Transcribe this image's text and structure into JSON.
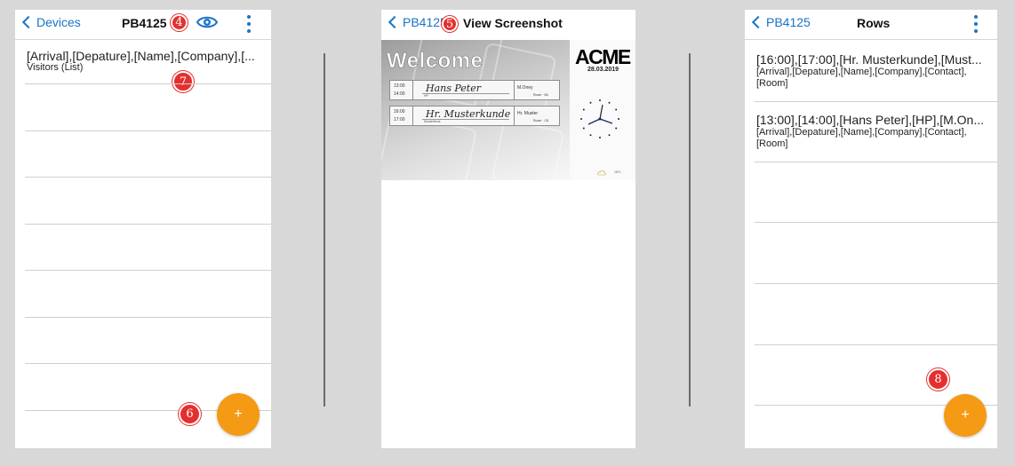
{
  "screen1": {
    "back_label": "Devices",
    "title": "PB4125",
    "badge_title": "4",
    "list_item": {
      "title": "[Arrival],[Depature],[Name],[Company],[...",
      "subtitle": "Visitors (List)"
    },
    "badge_list": "7",
    "badge_fab": "6",
    "fab_label": "+"
  },
  "screen2": {
    "back_label": "PB4125",
    "badge_back": "5",
    "title": "View Screenshot",
    "preview": {
      "welcome": "Welcome",
      "logo": "ACME",
      "date": "28.03.2019",
      "visits": [
        {
          "start": "13:00",
          "end": "14:00",
          "name": "Hans Peter",
          "company": "HP",
          "contact": "M.Oney",
          "room": "Room · B4"
        },
        {
          "start": "16:00",
          "end": "17:00",
          "name": "Hr. Musterkunde",
          "company": "Musterfirma",
          "contact": "Hr. Muster",
          "room": "Room · C8"
        }
      ],
      "weather_left": "",
      "weather_right": "16°C"
    }
  },
  "screen3": {
    "back_label": "PB4125",
    "title": "Rows",
    "rows": [
      {
        "title": "[16:00],[17:00],[Hr. Musterkunde],[Must...",
        "sub_line1": "[Arrival],[Depature],[Name],[Company],[Contact],",
        "sub_line2": "[Room]"
      },
      {
        "title": "[13:00],[14:00],[Hans Peter],[HP],[M.On...",
        "sub_line1": "[Arrival],[Depature],[Name],[Company],[Contact],",
        "sub_line2": "[Room]"
      }
    ],
    "badge_fab": "8",
    "fab_label": "+"
  },
  "colors": {
    "accent_blue": "#1a73c9",
    "fab_orange": "#f59a14",
    "badge_red": "#e52f2f",
    "background": "#d8d8d8"
  }
}
